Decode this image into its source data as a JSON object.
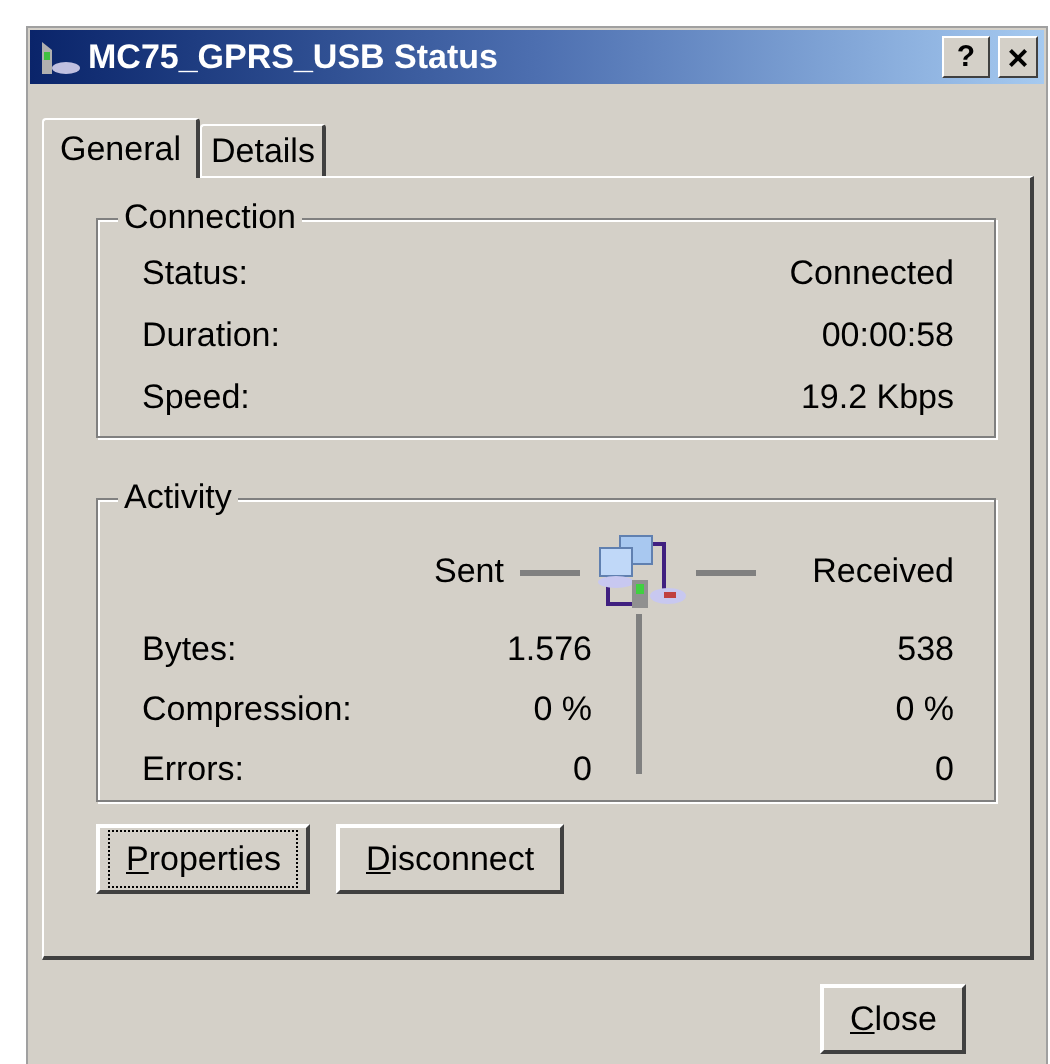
{
  "window": {
    "title": "MC75_GPRS_USB Status",
    "help_button": "?",
    "close_button": "×"
  },
  "tabs": [
    {
      "label": "General",
      "selected": true
    },
    {
      "label": "Details",
      "selected": false
    }
  ],
  "connection": {
    "title": "Connection",
    "rows": [
      {
        "label": "Status:",
        "value": "Connected"
      },
      {
        "label": "Duration:",
        "value": "00:00:58"
      },
      {
        "label": "Speed:",
        "value": "19.2 Kbps"
      }
    ]
  },
  "activity": {
    "title": "Activity",
    "sent_heading": "Sent",
    "received_heading": "Received",
    "rows": [
      {
        "label": "Bytes:",
        "sent": "1.576",
        "received": "538"
      },
      {
        "label": "Compression:",
        "sent": "0 %",
        "received": "0 %"
      },
      {
        "label": "Errors:",
        "sent": "0",
        "received": "0"
      }
    ]
  },
  "buttons": [
    {
      "key": "P",
      "rest": "roperties",
      "focused": true
    },
    {
      "key": "D",
      "rest": "isconnect",
      "focused": false
    }
  ],
  "footer_button": {
    "key": "C",
    "rest": "lose"
  }
}
